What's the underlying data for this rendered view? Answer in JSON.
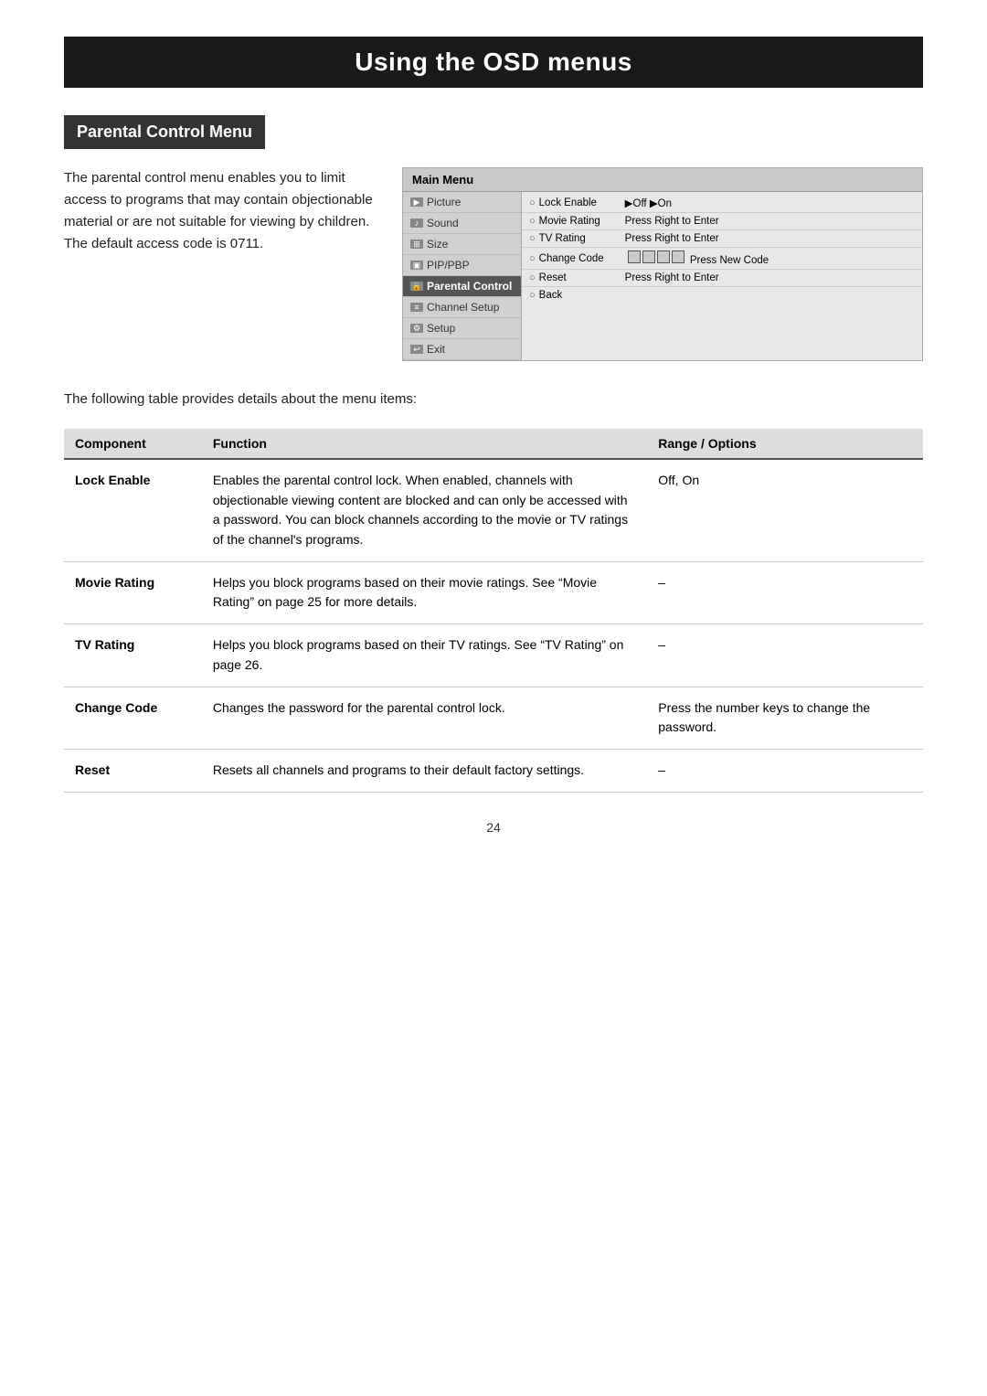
{
  "page": {
    "title": "Using the OSD menus",
    "section_header": "Parental Control Menu",
    "intro_paragraph": "The parental control menu enables you to limit access to programs that may contain objectionable material or are not suitable for viewing by children. The default access code is 0711.",
    "following_text": "The following table provides details about the menu items:",
    "page_number": "24"
  },
  "osd": {
    "title": "Main Menu",
    "menu_items": [
      {
        "icon": "📷",
        "label": "Picture",
        "active": false
      },
      {
        "icon": "🔊",
        "label": "Sound",
        "active": false
      },
      {
        "icon": "📐",
        "label": "Size",
        "active": false
      },
      {
        "icon": "📦",
        "label": "PIP/PBP",
        "active": false
      },
      {
        "icon": "🔒",
        "label": "Parental Control",
        "active": true
      },
      {
        "icon": "📡",
        "label": "Channel Setup",
        "active": false
      },
      {
        "icon": "⚙",
        "label": "Setup",
        "active": false
      },
      {
        "icon": "🚪",
        "label": "Exit",
        "active": false
      }
    ],
    "content_rows": [
      {
        "bullet": "○",
        "label": "Lock Enable",
        "value": "▶Off  ▶On"
      },
      {
        "bullet": "○",
        "label": "Movie Rating",
        "value": "Press Right to Enter"
      },
      {
        "bullet": "○",
        "label": "TV Rating",
        "value": "Press Right to Enter"
      },
      {
        "bullet": "○",
        "label": "Change Code",
        "value": "[code_boxes] Press New Code"
      },
      {
        "bullet": "○",
        "label": "Reset",
        "value": "Press Right to Enter"
      },
      {
        "bullet": "○",
        "label": "Back",
        "value": ""
      }
    ]
  },
  "table": {
    "headers": [
      "Component",
      "Function",
      "Range / Options"
    ],
    "rows": [
      {
        "component": "Lock Enable",
        "function": "Enables the parental control lock. When enabled, channels with objectionable viewing content are blocked and can only be accessed with a password. You can block channels according to the movie or TV ratings of the channel's programs.",
        "range": "Off, On"
      },
      {
        "component": "Movie Rating",
        "function": "Helps you block programs based on their movie ratings. See “Movie Rating” on page 25 for more details.",
        "range": "–"
      },
      {
        "component": "TV Rating",
        "function": "Helps you block programs based on their TV ratings. See “TV Rating” on page 26.",
        "range": "–"
      },
      {
        "component": "Change Code",
        "function": "Changes the password for the parental control lock.",
        "range": "Press the number keys to change the password."
      },
      {
        "component": "Reset",
        "function": "Resets all channels and programs to their default factory settings.",
        "range": "–"
      }
    ]
  }
}
